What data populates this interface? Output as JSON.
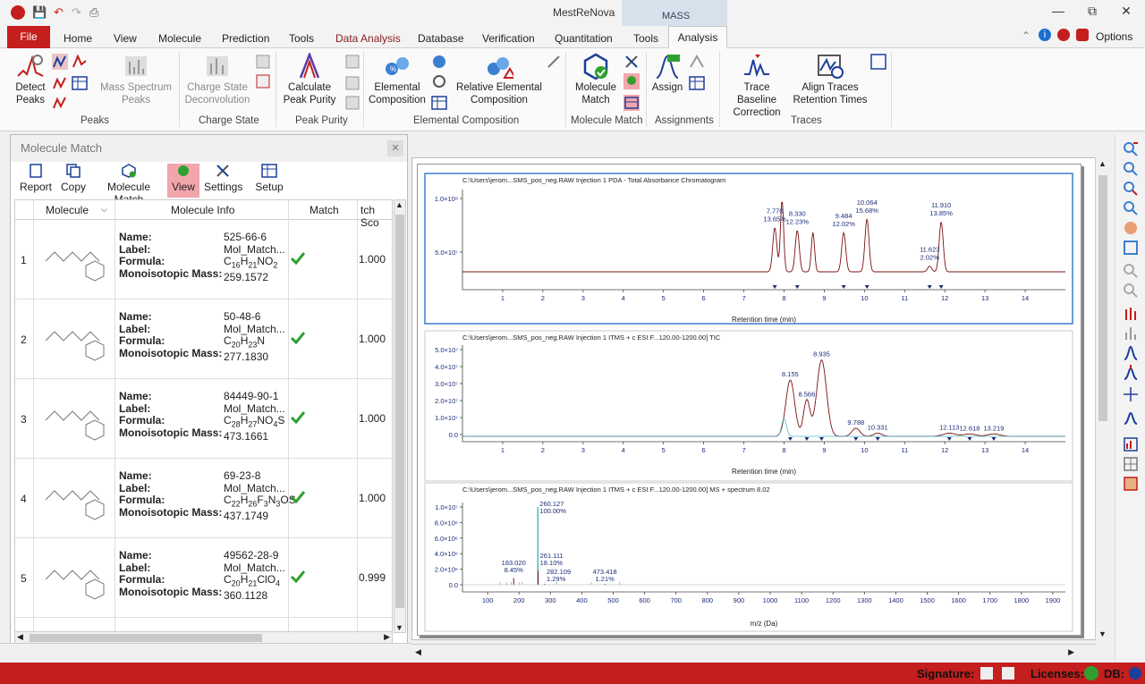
{
  "app": {
    "title": "MestReNova",
    "context_tab_group": "MASS"
  },
  "tabs": [
    "File",
    "Home",
    "View",
    "Molecule",
    "Prediction",
    "Tools",
    "Data Analysis",
    "Database",
    "Verification",
    "Quantitation",
    "Tools",
    "Analysis"
  ],
  "right_menu": {
    "options": "Options"
  },
  "ribbon": {
    "detect_peaks": "Detect Peaks",
    "mass_spectrum_peaks": "Mass Spectrum Peaks",
    "charge_state_deconvolution": "Charge State Deconvolution",
    "calculate_peak_purity": "Calculate Peak Purity",
    "elemental_composition": "Elemental Composition",
    "relative_elemental_composition": "Relative Elemental Composition",
    "molecule_match": "Molecule Match",
    "assign": "Assign",
    "trace_baseline_correction": "Trace Baseline Correction",
    "align_traces_retention_times": "Align Traces Retention Times",
    "groups": {
      "peaks": "Peaks",
      "charge_state": "Charge State",
      "peak_purity": "Peak Purity",
      "elemental_composition": "Elemental Composition",
      "molecule_match": "Molecule Match",
      "assignments": "Assignments",
      "traces": "Traces"
    }
  },
  "panel": {
    "title": "Molecule Match",
    "tools": [
      "Report",
      "Copy",
      "Molecule Match",
      "View",
      "Settings",
      "Setup"
    ],
    "columns": [
      "Molecule",
      "Molecule Info",
      "Match",
      "tch Sco"
    ],
    "field_labels": [
      "Name:",
      "Label:",
      "Formula:",
      "Monoisotopic Mass:"
    ],
    "rows": [
      {
        "n": "1",
        "name": "525-66-6",
        "label": "Mol_Match...",
        "formula": "C16H21NO2",
        "mass": "259.1572",
        "score": "1.000"
      },
      {
        "n": "2",
        "name": "50-48-6",
        "label": "Mol_Match...",
        "formula": "C20H23N",
        "mass": "277.1830",
        "score": "1.000"
      },
      {
        "n": "3",
        "name": "84449-90-1",
        "label": "Mol_Match...",
        "formula": "C28H27NO4S",
        "mass": "473.1661",
        "score": "1.000"
      },
      {
        "n": "4",
        "name": "69-23-8",
        "label": "Mol_Match...",
        "formula": "C22H26F3N3OS",
        "mass": "437.1749",
        "score": "1.000"
      },
      {
        "n": "5",
        "name": "49562-28-9",
        "label": "Mol_Match...",
        "formula": "C20H21ClO4",
        "mass": "360.1128",
        "score": "0.999"
      }
    ]
  },
  "chart_data": [
    {
      "type": "line",
      "title": "C:\\Users\\jerom...SMS_pos_neg.RAW Injection 1  PDA - Total Absorbance Chromatogram",
      "xlabel": "Retention time (min)",
      "xlim": [
        0,
        15
      ],
      "xticks": [
        "1",
        "2",
        "3",
        "4",
        "5",
        "6",
        "7",
        "8",
        "9",
        "10",
        "11",
        "12",
        "13",
        "14"
      ],
      "yticks": [
        "1.0×10⁸",
        "5.0×10⁷"
      ],
      "peaks": [
        {
          "x": 7.77,
          "label": "7.770",
          "pct": "13.65%"
        },
        {
          "x": 8.33,
          "label": "8.330",
          "pct": "12.23%"
        },
        {
          "x": 9.484,
          "label": "9.484",
          "pct": "12.02%"
        },
        {
          "x": 10.064,
          "label": "10.064",
          "pct": "15.68%"
        },
        {
          "x": 11.623,
          "label": "11.623",
          "pct": "2.02%"
        },
        {
          "x": 11.91,
          "label": "11.910",
          "pct": "13.85%"
        }
      ]
    },
    {
      "type": "line",
      "title": "C:\\Users\\jerom...SMS_pos_neg.RAW Injection 1 ITMS + c ESI F...120.00-1200.00] TIC",
      "xlabel": "Retention time (min)",
      "xlim": [
        0,
        15
      ],
      "xticks": [
        "1",
        "2",
        "3",
        "4",
        "5",
        "6",
        "7",
        "8",
        "9",
        "10",
        "11",
        "12",
        "13",
        "14"
      ],
      "yticks": [
        "5.0×10⁷",
        "4.0×10⁷",
        "3.0×10⁷",
        "2.0×10⁷",
        "1.0×10⁷",
        "0.0"
      ],
      "peaks": [
        {
          "x": 8.155,
          "label": "8.155"
        },
        {
          "x": 8.566,
          "label": "8.566"
        },
        {
          "x": 8.935,
          "label": "8.935"
        },
        {
          "x": 9.788,
          "label": "9.788"
        },
        {
          "x": 10.331,
          "label": "10.331"
        },
        {
          "x": 12.113,
          "label": "12.113"
        },
        {
          "x": 12.618,
          "label": "12.618"
        },
        {
          "x": 13.219,
          "label": "13.219"
        }
      ]
    },
    {
      "type": "bar",
      "title": "C:\\Users\\jerom...SMS_pos_neg.RAW Injection 1 ITMS + c ESI F...120.00-1200.00] MS + spectrum 8.02",
      "xlabel": "m/z (Da)",
      "xlim": [
        20,
        1940
      ],
      "xticks": [
        "100",
        "200",
        "300",
        "400",
        "500",
        "600",
        "700",
        "800",
        "900",
        "1000",
        "1100",
        "1200",
        "1300",
        "1400",
        "1500",
        "1600",
        "1700",
        "1800",
        "1900"
      ],
      "yticks": [
        "1.0×10⁷",
        "8.0×10⁶",
        "6.0×10⁶",
        "4.0×10⁶",
        "2.0×10⁶",
        "0.0"
      ],
      "peaks": [
        {
          "x": 183.02,
          "label": "183.020",
          "pct": "8.45%"
        },
        {
          "x": 260.127,
          "label": "260.127",
          "pct": "100.00%"
        },
        {
          "x": 261.111,
          "label": "261.111",
          "pct": "18.10%"
        },
        {
          "x": 282.109,
          "label": "282.109",
          "pct": "1.29%"
        },
        {
          "x": 473.418,
          "label": "473.418",
          "pct": "1.21%"
        }
      ]
    }
  ],
  "status": {
    "signature": "Signature:",
    "licenses": "Licenses:",
    "db": "DB:"
  },
  "colors": {
    "brand": "#c41e1e",
    "trace": "#7a1010",
    "axis": "#1c2c7a",
    "accent": "#3c7fd1"
  }
}
